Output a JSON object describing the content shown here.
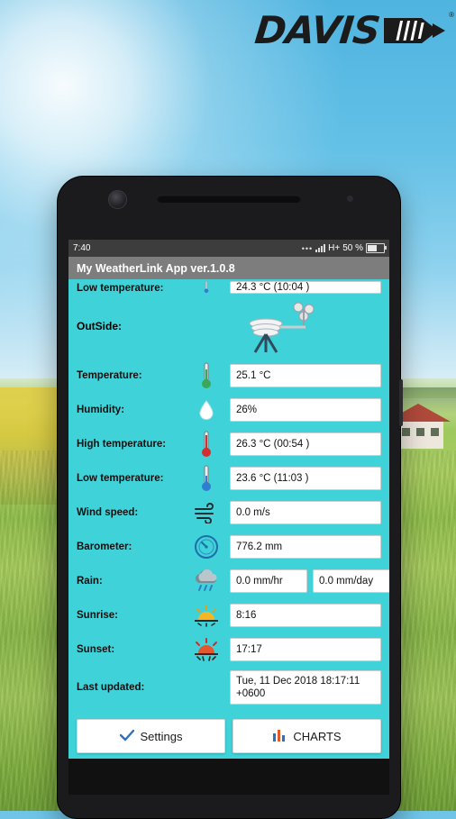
{
  "brand": {
    "logo_text": "DAVIS",
    "trademark": "®"
  },
  "phone": {
    "status_bar": {
      "time": "7:40",
      "network": "H+",
      "battery_percent": "50 %"
    },
    "app_bar": {
      "title": "My WeatherLink App ver.1.0.8"
    },
    "partial_row": {
      "label": "Low temperature:",
      "value": "24.3 °C  (10:04 )",
      "icon": "thermometer-low-icon"
    },
    "section": {
      "title": "OutSide:",
      "icon": "weather-station-icon"
    },
    "rows": [
      {
        "label": "Temperature:",
        "icon": "thermometer-icon",
        "value": "25.1 °C"
      },
      {
        "label": "Humidity:",
        "icon": "humidity-drop-icon",
        "value": "26%"
      },
      {
        "label": "High temperature:",
        "icon": "thermometer-high-icon",
        "value": "26.3 °C  (00:54 )"
      },
      {
        "label": "Low temperature:",
        "icon": "thermometer-low-icon",
        "value": "23.6 °C  (11:03 )"
      },
      {
        "label": "Wind speed:",
        "icon": "wind-icon",
        "value": "0.0 m/s"
      },
      {
        "label": "Barometer:",
        "icon": "barometer-gauge-icon",
        "value": "776.2 mm"
      }
    ],
    "rain_row": {
      "label": "Rain:",
      "icon": "rain-cloud-icon",
      "rate_value": "0.0 mm/hr",
      "day_value": "0.0 mm/day"
    },
    "sunrise_row": {
      "label": "Sunrise:",
      "icon": "sunrise-icon",
      "value": "8:16"
    },
    "sunset_row": {
      "label": "Sunset:",
      "icon": "sunset-icon",
      "value": "17:17"
    },
    "last_updated_row": {
      "label": "Last updated:",
      "value": "Tue, 11 Dec 2018 18:17:11\n+0600"
    },
    "buttons": {
      "settings": {
        "label": "Settings",
        "icon": "check-icon"
      },
      "charts": {
        "label": "CHARTS",
        "icon": "bar-chart-icon"
      }
    }
  },
  "colors": {
    "screen_bg": "#3fd2d8",
    "app_bar": "#7d7d7d",
    "status_bar": "#3d3d3d",
    "field_bg": "#ffffff"
  }
}
